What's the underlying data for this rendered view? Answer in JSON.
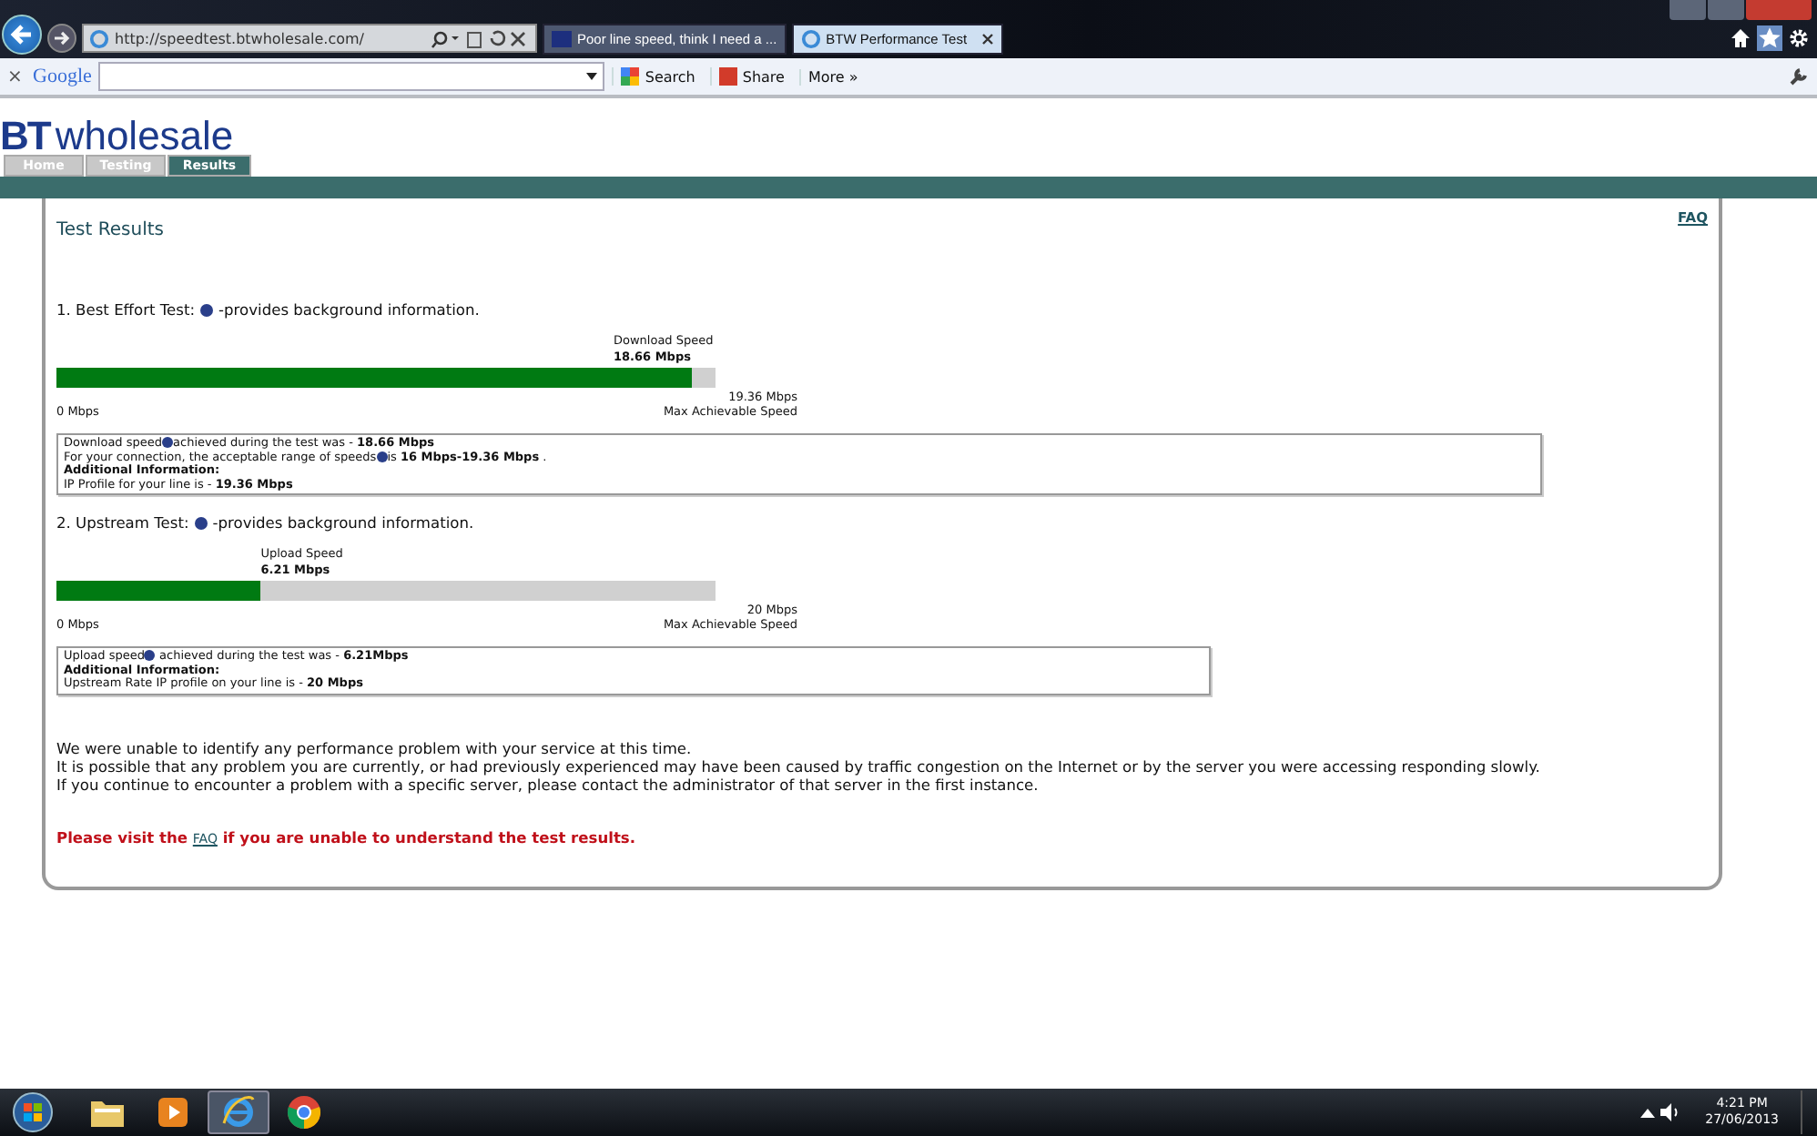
{
  "browser": {
    "address": "http://speedtest.btwholesale.com/",
    "tabs": [
      {
        "title": "Poor line speed, think I need a ...",
        "selected": false
      },
      {
        "title": "BTW Performance Test",
        "selected": true
      }
    ]
  },
  "toolbar": {
    "close": "×",
    "brand": "Google",
    "buttons": [
      "Search",
      "Share",
      "More »"
    ]
  },
  "site": {
    "logo_bold": "BT",
    "logo_rest": "wholesale",
    "nav": [
      {
        "label": "Home",
        "selected": false
      },
      {
        "label": "Testing",
        "selected": false
      },
      {
        "label": "Results",
        "selected": true
      }
    ],
    "faq_link": "FAQ",
    "title": "Test Results"
  },
  "tests": [
    {
      "heading": "1. Best Effort Test:",
      "note": "-provides background information.",
      "gauge_label": "Download Speed",
      "gauge_value": "18.66 Mbps",
      "level": 0.964,
      "min": "0 Mbps",
      "max": "19.36 Mbps",
      "max_caption": "Max Achievable Speed",
      "info": [
        {
          "kind": "text",
          "text": "Download speed",
          "help": true,
          "rest": "achieved during the test was - **18.66 Mbps**"
        },
        {
          "kind": "text",
          "text": "For your connection, the acceptable range of speeds",
          "help": true,
          "rest": "is **16 Mbps-19.36 Mbps** ."
        },
        {
          "kind": "heading",
          "text": "Additional Information:"
        },
        {
          "kind": "text",
          "text": "IP Profile for your line is - **19.36 Mbps**",
          "help": false
        }
      ]
    },
    {
      "heading": "2. Upstream Test:",
      "note": "-provides background information.",
      "gauge_label": "Upload Speed",
      "gauge_value": "6.21 Mbps",
      "level": 0.31,
      "min": "0 Mbps",
      "max": "20 Mbps",
      "max_caption": "Max Achievable Speed",
      "info": [
        {
          "kind": "text",
          "text": "Upload speed",
          "help": true,
          "rest": " achieved during the test was - **6.21Mbps**"
        },
        {
          "kind": "heading",
          "text": "Additional Information:"
        },
        {
          "kind": "text",
          "text": "Upstream Rate IP profile on your line is - **20 Mbps**",
          "help": false
        }
      ]
    }
  ],
  "messages": [
    "We were unable to identify any performance problem with your service at this time.",
    "It is possible that any problem you are currently, or had previously experienced may have been caused by traffic congestion on the Internet or by the server you were accessing responding slowly.",
    "If you continue to encounter a problem with a specific server, please contact the administrator of that server in the first instance."
  ],
  "faq_notice": {
    "before": "Please visit the ",
    "link": "FAQ",
    "after": " if you are unable to understand the test results."
  },
  "taskbar": {
    "apps": [
      {
        "kind": "folder",
        "selected": false
      },
      {
        "kind": "media",
        "selected": false
      },
      {
        "kind": "ie",
        "selected": true
      },
      {
        "kind": "chrome",
        "selected": false
      }
    ],
    "time": "4:21 PM",
    "date": "27/06/2013"
  }
}
